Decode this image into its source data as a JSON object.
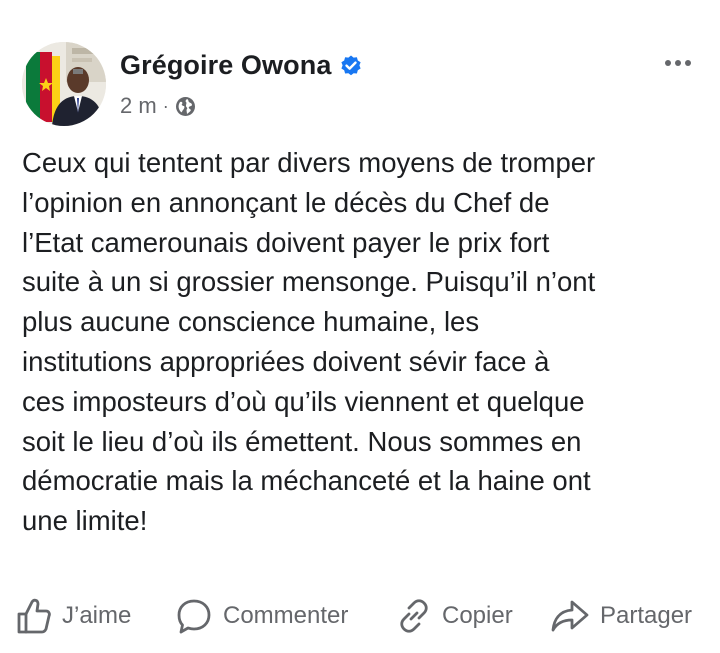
{
  "post": {
    "author": {
      "name": "Grégoire Owona",
      "verified": true,
      "avatar_icon": "profile-photo"
    },
    "meta": {
      "time": "2 m",
      "separator": "·",
      "audience_icon": "globe-icon"
    },
    "more_icon": "more-dots-icon",
    "text": "Ceux qui tentent par divers moyens de tromper\nl’opinion en annonçant le décès du Chef de\nl’Etat camerounais doivent payer le prix fort\nsuite à un si grossier mensonge. Puisqu’il n’ont\nplus aucune conscience humaine, les\ninstitutions appropriées doivent sévir face à\nces imposteurs d’où qu’ils viennent et quelque\nsoit le lieu d’où ils émettent. Nous sommes en\ndémocratie mais la méchanceté et la haine ont\nune limite!"
  },
  "actions": {
    "like": {
      "label": "J’aime",
      "icon": "thumbs-up-icon"
    },
    "comment": {
      "label": "Commenter",
      "icon": "comment-bubble-icon"
    },
    "copy": {
      "label": "Copier",
      "icon": "link-icon"
    },
    "share": {
      "label": "Partager",
      "icon": "share-arrow-icon"
    }
  },
  "colors": {
    "text": "#1c1e21",
    "secondary": "#65676b",
    "verified": "#1877f2"
  }
}
